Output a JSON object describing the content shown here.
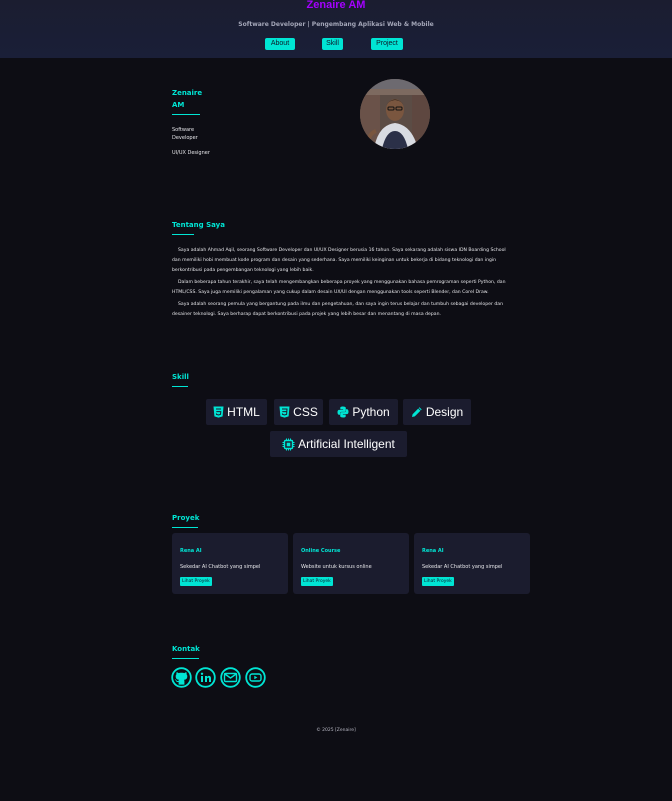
{
  "header": {
    "title": "Zenaire AM",
    "subtitle": "Software Developer | Pengembang Aplikasi Web & Mobile",
    "nav": [
      {
        "label": "About"
      },
      {
        "label": "Skill"
      },
      {
        "label": "Project"
      }
    ]
  },
  "hero": {
    "name": "Zenaire AM",
    "roles": [
      "Software Developer",
      "UI/UX Designer"
    ]
  },
  "about": {
    "title": "Tentang Saya",
    "paragraphs": [
      "Saya adalah Ahmad Aqil, seorang Software Developer dan UI/UX Designer berusia 16 tahun. Saya sekarang adalah siswa IDN Boarding School dan memiliki hobi membuat kode program dan desain yang sederhana. Saya memiliki keinginan untuk bekerja di bidang teknologi dan ingin berkontribusi pada pengembangan teknologi yang lebih baik.",
      "Dalam beberapa tahun terakhir, saya telah mengembangkan beberapa proyek yang menggunakan bahasa pemrograman seperti Python, dan HTML/CSS. Saya juga memiliki pengalaman yang cukup dalam desain UX/UI dengan menggunakan tools seperti Blender, dan Corel Draw.",
      "Saya adalah seorang pemula yang bergantung pada ilmu dan pengetahuan, dan saya ingin terus belajar dan tumbuh sebagai developer dan desainer teknologi. Saya berharap dapat berkontribusi pada projek yang lebih besar dan menantang di masa depan."
    ]
  },
  "skills": {
    "title": "Skill",
    "items": [
      {
        "label": "HTML",
        "icon": "html5-icon"
      },
      {
        "label": "CSS",
        "icon": "css3-icon"
      },
      {
        "label": "Python",
        "icon": "python-icon"
      },
      {
        "label": "Design",
        "icon": "pencil-icon"
      },
      {
        "label": "Artificial Intelligent",
        "icon": "chip-icon"
      }
    ]
  },
  "projects": {
    "title": "Proyek",
    "items": [
      {
        "title": "Rena AI",
        "desc": "Sekedar AI Chatbot yang simpel",
        "button": "Lihat Proyek"
      },
      {
        "title": "Online Course",
        "desc": "Website untuk kursus online",
        "button": "Lihat Proyek"
      },
      {
        "title": "Rena AI",
        "desc": "Sekedar AI Chatbot yang simpel",
        "button": "Lihat Proyek"
      }
    ]
  },
  "contact": {
    "title": "Kontak",
    "items": [
      {
        "icon": "github-icon"
      },
      {
        "icon": "linkedin-icon"
      },
      {
        "icon": "email-icon"
      },
      {
        "icon": "youtube-icon"
      }
    ]
  },
  "footer": {
    "text": "© 2025 [Zenaire]"
  },
  "colors": {
    "accent": "#00e5d4",
    "brand": "#a400ff",
    "background": "#0d0d14",
    "card": "#1b1c2e"
  }
}
